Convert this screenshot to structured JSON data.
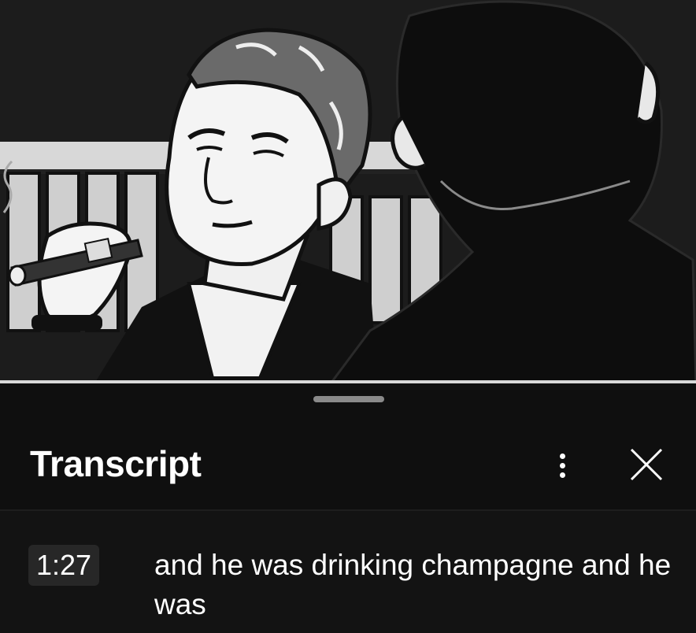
{
  "video": {
    "frame": "comic-cigar-scene"
  },
  "panel": {
    "title": "Transcript",
    "menu_icon": "more-vert-icon",
    "close_icon": "close-icon"
  },
  "segments": [
    {
      "timestamp": "1:27",
      "text": "and he was drinking champagne and he was"
    }
  ],
  "colors": {
    "background": "#0f0f0f",
    "chip": "#272727",
    "text": "#ffffff"
  }
}
